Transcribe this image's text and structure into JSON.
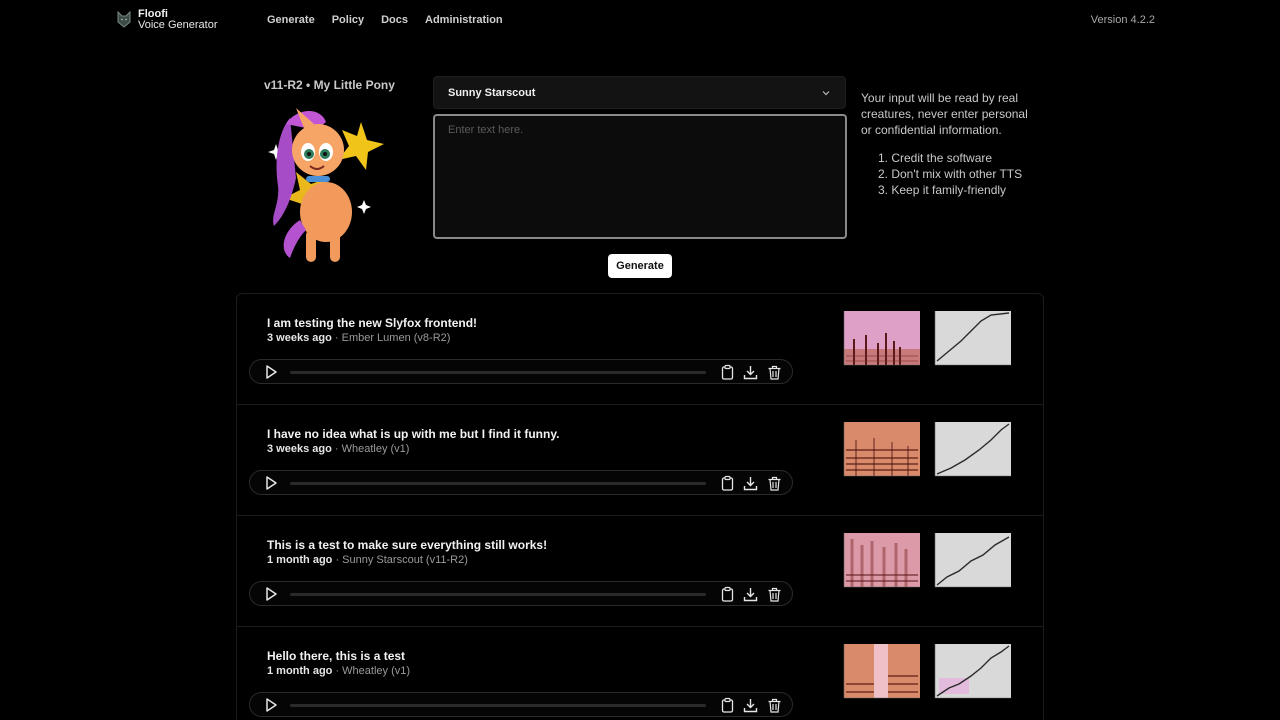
{
  "app": {
    "name": "Floofi",
    "subtitle": "Voice Generator",
    "version_label": "Version 4.2.2"
  },
  "nav": [
    "Generate",
    "Policy",
    "Docs",
    "Administration"
  ],
  "composer": {
    "model_title": "v11-R2 • My Little Pony",
    "voice": "Sunny Starscout",
    "placeholder": "Enter text here.",
    "generate_label": "Generate"
  },
  "notice": {
    "text": "Your input will be read by real creatures, never enter personal or confidential information.",
    "rules": [
      "1. Credit the software",
      "2. Don't mix with other TTS",
      "3. Keep it family-friendly"
    ]
  },
  "history": [
    {
      "text": "I am testing the new Slyfox frontend!",
      "age": "3 weeks ago",
      "voice": " · Ember Lumen (v8-R2)"
    },
    {
      "text": "I have no idea what is up with me but I find it funny.",
      "age": "3 weeks ago",
      "voice": " · Wheatley (v1)"
    },
    {
      "text": "This is a test to make sure everything still works!",
      "age": "1 month ago",
      "voice": " · Sunny Starscout (v11-R2)"
    },
    {
      "text": "Hello there, this is a test",
      "age": "1 month ago",
      "voice": " · Wheatley (v1)"
    }
  ],
  "icons": {
    "logo": "floofi-logo-icon",
    "dropdown": "chevron-down-icon",
    "play": "play-icon",
    "copy": "clipboard-icon",
    "download": "download-icon",
    "delete": "trash-icon"
  },
  "colors": {
    "background": "#000000",
    "accent": "#ffffff",
    "spectrogram": "#d98a8a",
    "alignment_plot": "#d9d9d9"
  }
}
